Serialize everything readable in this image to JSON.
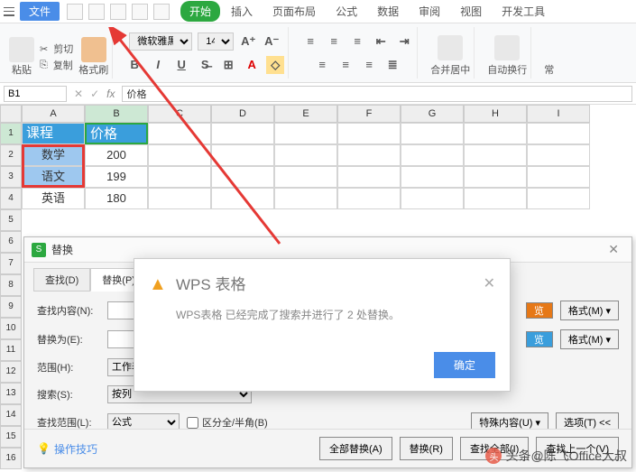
{
  "menubar": {
    "file": "文件"
  },
  "tabs": {
    "start": "开始",
    "insert": "插入",
    "layout": "页面布局",
    "formula": "公式",
    "data": "数据",
    "review": "审阅",
    "view": "视图",
    "dev": "开发工具"
  },
  "ribbon": {
    "paste": "粘贴",
    "cut": "剪切",
    "copy": "复制",
    "format_painter": "格式刷",
    "font": "微软雅黑",
    "size": "14",
    "merge": "合并居中",
    "wrap": "自动换行",
    "settings": "常"
  },
  "namebox": {
    "ref": "B1",
    "fx": "fx",
    "value": "价格"
  },
  "columns": [
    "A",
    "B",
    "C",
    "D",
    "E",
    "F",
    "G",
    "H",
    "I"
  ],
  "rows": [
    "1",
    "2",
    "3",
    "4",
    "5",
    "6",
    "7",
    "8",
    "9",
    "10",
    "11",
    "12",
    "13",
    "14",
    "15",
    "16"
  ],
  "sheet": {
    "A1": "课程",
    "B1": "价格",
    "A2": "数学",
    "B2": "200",
    "A3": "语文",
    "B3": "199",
    "A4": "英语",
    "B4": "180"
  },
  "dialog": {
    "title": "替换",
    "tab_find": "查找(D)",
    "tab_replace": "替换(P)",
    "find_label": "查找内容(N):",
    "replace_label": "替换为(E):",
    "range_label": "范围(H):",
    "range_val": "工作表",
    "search_label": "搜索(S):",
    "search_val": "按列",
    "lookin_label": "查找范围(L):",
    "lookin_val": "公式",
    "halfwidth": "区分全/半角(B)",
    "preview": "览",
    "format_btn": "格式(M)",
    "special": "特殊内容(U)",
    "options": "选项(T) <<",
    "tips": "操作技巧",
    "btn_replace_all": "全部替换(A)",
    "btn_replace": "替换(R)",
    "btn_find_all": "查找全部(I)",
    "btn_find_prev": "查找上一个(V)"
  },
  "alert": {
    "title": "WPS 表格",
    "message": "WPS表格 已经完成了搜索并进行了 2 处替换。",
    "ok": "确定"
  },
  "watermark": {
    "text": "头条@陈飞Office大叔"
  }
}
